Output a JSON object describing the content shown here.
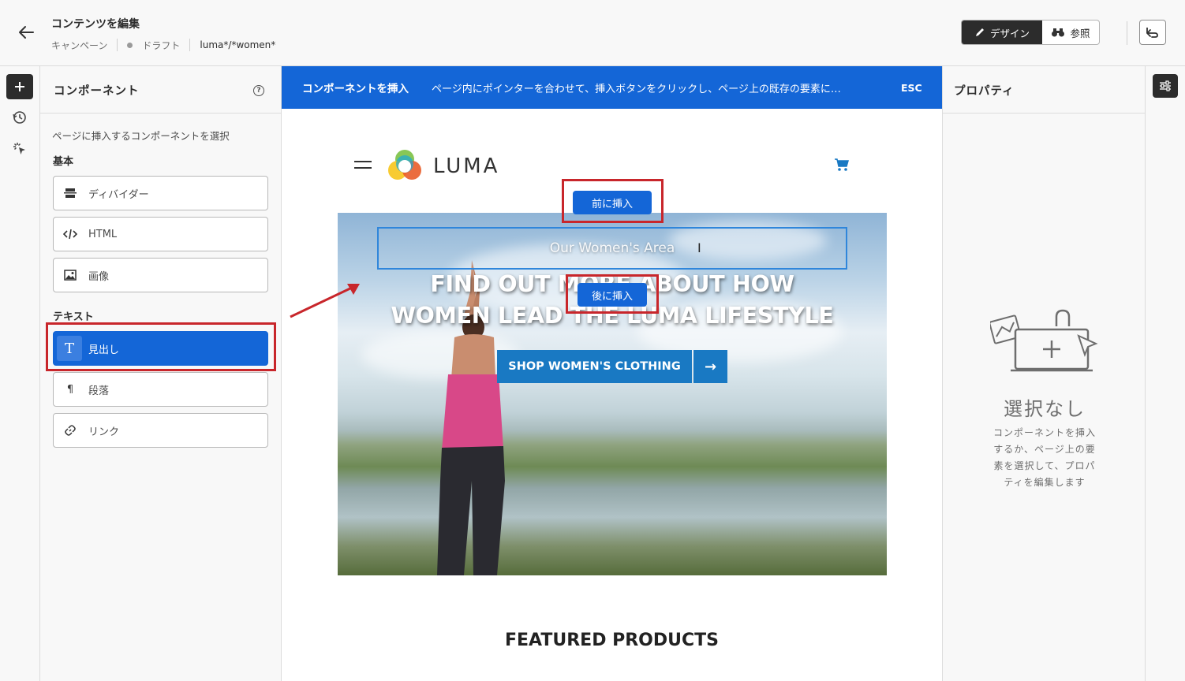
{
  "header": {
    "title": "コンテンツを編集",
    "breadcrumb": [
      "キャンペーン",
      "ドラフト",
      "luma*/*women*"
    ],
    "design_label": "デザイン",
    "browse_label": "参照"
  },
  "components_panel": {
    "title": "コンポーネント",
    "help": "?",
    "subtitle": "ページに挿入するコンポーネントを選択",
    "section_basic": "基本",
    "section_text": "テキスト",
    "basic_items": [
      "ディバイダー",
      "HTML",
      "画像"
    ],
    "text_items": [
      "見出し",
      "段落",
      "リンク"
    ],
    "selected_item": "見出し"
  },
  "banner": {
    "title": "コンポーネントを挿入",
    "message": "ページ内にポインターを合わせて、挿入ボタンをクリックし、ページ上の既存の要素に…",
    "esc": "ESC"
  },
  "page": {
    "brand": "LUMA",
    "hero_selected_text": "Our Women's Area",
    "hero_line1": "FIND OUT MORE ABOUT HOW",
    "hero_line2": "WOMEN LEAD THE LUMA LIFESTYLE",
    "shop_button": "SHOP WOMEN'S CLOTHING",
    "insert_before": "前に挿入",
    "insert_after": "後に挿入",
    "featured": "FEATURED PRODUCTS"
  },
  "properties": {
    "title": "プロパティ",
    "empty_title": "選択なし",
    "empty_desc": "コンポーネントを挿入するか、ページ上の要素を選択して、プロパティを編集します"
  },
  "colors": {
    "accent": "#1466d7",
    "highlight": "#c8262b",
    "luma_blue": "#1979c3"
  }
}
